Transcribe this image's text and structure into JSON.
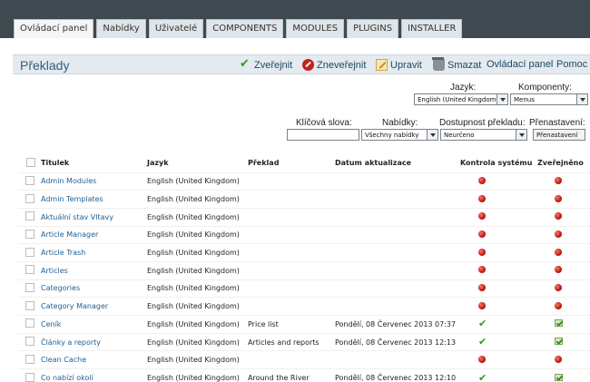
{
  "tabs": [
    "Ovládací panel",
    "Nabídky",
    "Uživatelé",
    "COMPONENTS",
    "MODULES",
    "PLUGINS",
    "INSTALLER"
  ],
  "page_title": "Překlady",
  "toolbar": {
    "publish": "Zveřejnit",
    "unpublish": "Zneveřejnit",
    "edit": "Upravit",
    "delete": "Smazat",
    "control_panel": "Ovládací panel",
    "help": "Pomoc"
  },
  "filters": {
    "language_label": "Jazyk:",
    "language_value": "English (United Kingdom)",
    "components_label": "Komponenty:",
    "components_value": "Menus",
    "keywords_label": "Klíčová slova:",
    "keywords_value": "",
    "menus_label": "Nabídky:",
    "menus_value": "Všechny nabídky",
    "availability_label": "Dostupnost překladu:",
    "availability_value": "Neurčeno",
    "reset_label": "Přenastavení:",
    "reset_button": "Přenastavení"
  },
  "table": {
    "headers": [
      "Titulek",
      "Jazyk",
      "Překlad",
      "Datum aktualizace",
      "Kontrola systému",
      "Zveřejněno"
    ],
    "rows": [
      {
        "title": "Admin Modules",
        "language": "English (United Kingdom)",
        "translation": "",
        "date": "",
        "control": "red",
        "published": "red"
      },
      {
        "title": "Admin Templates",
        "language": "English (United Kingdom)",
        "translation": "",
        "date": "",
        "control": "red",
        "published": "red"
      },
      {
        "title": "Aktuální stav Vltavy",
        "language": "English (United Kingdom)",
        "translation": "",
        "date": "",
        "control": "red",
        "published": "red"
      },
      {
        "title": "Article Manager",
        "language": "English (United Kingdom)",
        "translation": "",
        "date": "",
        "control": "red",
        "published": "red"
      },
      {
        "title": "Article Trash",
        "language": "English (United Kingdom)",
        "translation": "",
        "date": "",
        "control": "red",
        "published": "red"
      },
      {
        "title": "Articles",
        "language": "English (United Kingdom)",
        "translation": "",
        "date": "",
        "control": "red",
        "published": "red"
      },
      {
        "title": "Categories",
        "language": "English (United Kingdom)",
        "translation": "",
        "date": "",
        "control": "red",
        "published": "red"
      },
      {
        "title": "Category Manager",
        "language": "English (United Kingdom)",
        "translation": "",
        "date": "",
        "control": "red",
        "published": "red"
      },
      {
        "title": "Ceník",
        "language": "English (United Kingdom)",
        "translation": "Price list",
        "date": "Pondělí, 08 Červenec 2013 07:37",
        "control": "green",
        "published": "green"
      },
      {
        "title": "Články a reporty",
        "language": "English (United Kingdom)",
        "translation": "Articles and reports",
        "date": "Pondělí, 08 Červenec 2013 12:13",
        "control": "green",
        "published": "green"
      },
      {
        "title": "Clean Cache",
        "language": "English (United Kingdom)",
        "translation": "",
        "date": "",
        "control": "red",
        "published": "red"
      },
      {
        "title": "Co nabízí okolí",
        "language": "English (United Kingdom)",
        "translation": "Around the River",
        "date": "Pondělí, 08 Červenec 2013 12:10",
        "control": "green",
        "published": "green"
      }
    ]
  },
  "colors": {
    "accent": "#1f5f93",
    "topbar": "#3f4a50",
    "toolbar": "#e4eaee"
  }
}
